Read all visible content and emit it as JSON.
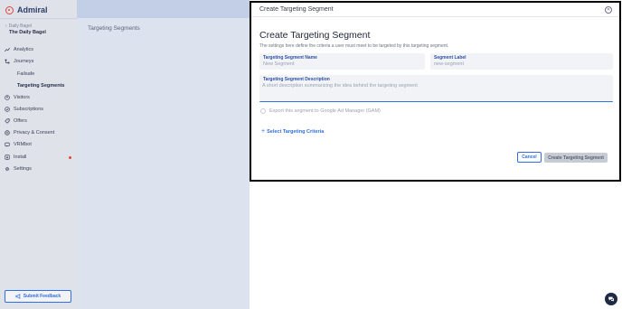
{
  "brand": {
    "name": "Admiral",
    "logo_icon": "admiral-logo-icon"
  },
  "publisher": {
    "small_label": "Daily Bagel",
    "name": "The Daily Bagel"
  },
  "sidebar": {
    "items": [
      {
        "label": "Analytics",
        "icon": "chart-line-icon"
      },
      {
        "label": "Journeys",
        "icon": "journeys-icon"
      },
      {
        "label": "Visitors",
        "icon": "visitors-icon"
      },
      {
        "label": "Subscriptions",
        "icon": "subscriptions-icon"
      },
      {
        "label": "Offers",
        "icon": "offers-icon"
      },
      {
        "label": "Privacy & Consent",
        "icon": "privacy-icon"
      },
      {
        "label": "VRMbot",
        "icon": "bot-icon"
      },
      {
        "label": "Install",
        "icon": "install-icon"
      },
      {
        "label": "Settings",
        "icon": "gear-icon"
      }
    ],
    "sub_items": [
      {
        "label": "Failsafe"
      },
      {
        "label": "Targeting Segments"
      }
    ],
    "feedback_label": "Submit Feedback"
  },
  "main": {
    "page_title": "Targeting Segments"
  },
  "modal": {
    "header_title": "Create Targeting Segment",
    "title": "Create Targeting Segment",
    "description": "The settings here define the criteria a user must meet to be targeted by this targeting segment.",
    "fields": {
      "name_label": "Targeting Segment Name",
      "name_placeholder": "New Segment",
      "label_label": "Segment Label",
      "label_placeholder": "new-segment",
      "desc_label": "Targeting Segment Description",
      "desc_placeholder": "A short description summarizing the idea behind the targeting segment"
    },
    "export_label": "Export this segment to Google Ad Manager (GAM)",
    "criteria_link": "Select Targeting Criteria",
    "cancel_label": "Cancel",
    "create_label": "Create Targeting Segment"
  },
  "colors": {
    "accent": "#2f6fdf",
    "sidebar_bg": "#dfe2e9",
    "main_bg": "#dde3ee",
    "brand_red": "#e0453a",
    "chat_bg": "#1f2a44"
  }
}
